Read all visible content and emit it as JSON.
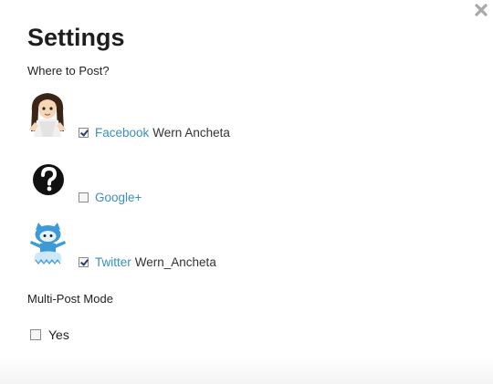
{
  "dialog": {
    "title": "Settings",
    "close_icon": "close-icon"
  },
  "where_to_post": {
    "label": "Where to Post?",
    "accounts": [
      {
        "network": "Facebook",
        "account": "Wern Ancheta",
        "checked": true,
        "avatar": "girl-avatar-icon"
      },
      {
        "network": "Google+",
        "account": "",
        "checked": false,
        "avatar": "question-mark-icon"
      },
      {
        "network": "Twitter",
        "account": "Wern_Ancheta",
        "checked": true,
        "avatar": "octocat-avatar-icon"
      }
    ]
  },
  "multi_post": {
    "label": "Multi-Post Mode",
    "option_label": "Yes",
    "checked": false
  },
  "colors": {
    "link": "#3a8fbd",
    "title": "#1e1e1e"
  }
}
